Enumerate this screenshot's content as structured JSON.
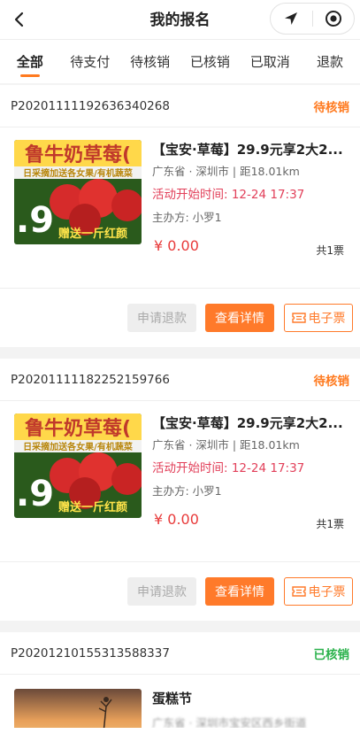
{
  "header": {
    "title": "我的报名",
    "back_icon": "chevron-left-icon",
    "capsule_icons": [
      "navigation-arrow-icon",
      "record-circle-icon"
    ]
  },
  "tabs": [
    {
      "label": "全部",
      "active": true
    },
    {
      "label": "待支付",
      "active": false
    },
    {
      "label": "待核销",
      "active": false
    },
    {
      "label": "已核销",
      "active": false
    },
    {
      "label": "已取消",
      "active": false
    },
    {
      "label": "退款",
      "active": false
    }
  ],
  "orders": [
    {
      "order_no": "P20201111192636340268",
      "status": "待核销",
      "image_text": {
        "top": "鲁牛奶草莓(",
        "banner": "日采摘加送各女果/有机蔬菜",
        "price": ".9",
        "bottom": "赠送一斤红颜"
      },
      "title": "【宝安·草莓】29.9元享2大2...",
      "location": "广东省 · 深圳市 | 距18.01km",
      "start_time": "活动开始时间:  12-24 17:37",
      "organizer": "主办方:  小罗1",
      "price": "¥ 0.00",
      "qty": "共1票",
      "btn_refund": "申请退款",
      "btn_detail": "查看详情",
      "btn_ticket": "电子票"
    },
    {
      "order_no": "P20201111182252159766",
      "status": "待核销",
      "image_text": {
        "top": "鲁牛奶草莓(",
        "banner": "日采摘加送各女果/有机蔬菜",
        "price": ".9",
        "bottom": "赠送一斤红颜"
      },
      "title": "【宝安·草莓】29.9元享2大2...",
      "location": "广东省 · 深圳市 | 距18.01km",
      "start_time": "活动开始时间:  12-24 17:37",
      "organizer": "主办方:  小罗1",
      "price": "¥ 0.00",
      "qty": "共1票",
      "btn_refund": "申请退款",
      "btn_detail": "查看详情",
      "btn_ticket": "电子票"
    },
    {
      "order_no": "P20201210155313588337",
      "status": "已核销",
      "title": "蛋糕节",
      "location": "广东省 · 深圳市宝安区西乡街道"
    }
  ],
  "colors": {
    "accent": "#ff7a2a",
    "pending": "#ff7a1f",
    "done": "#2bb24c",
    "time": "#e2405a",
    "price": "#e83a3a"
  }
}
